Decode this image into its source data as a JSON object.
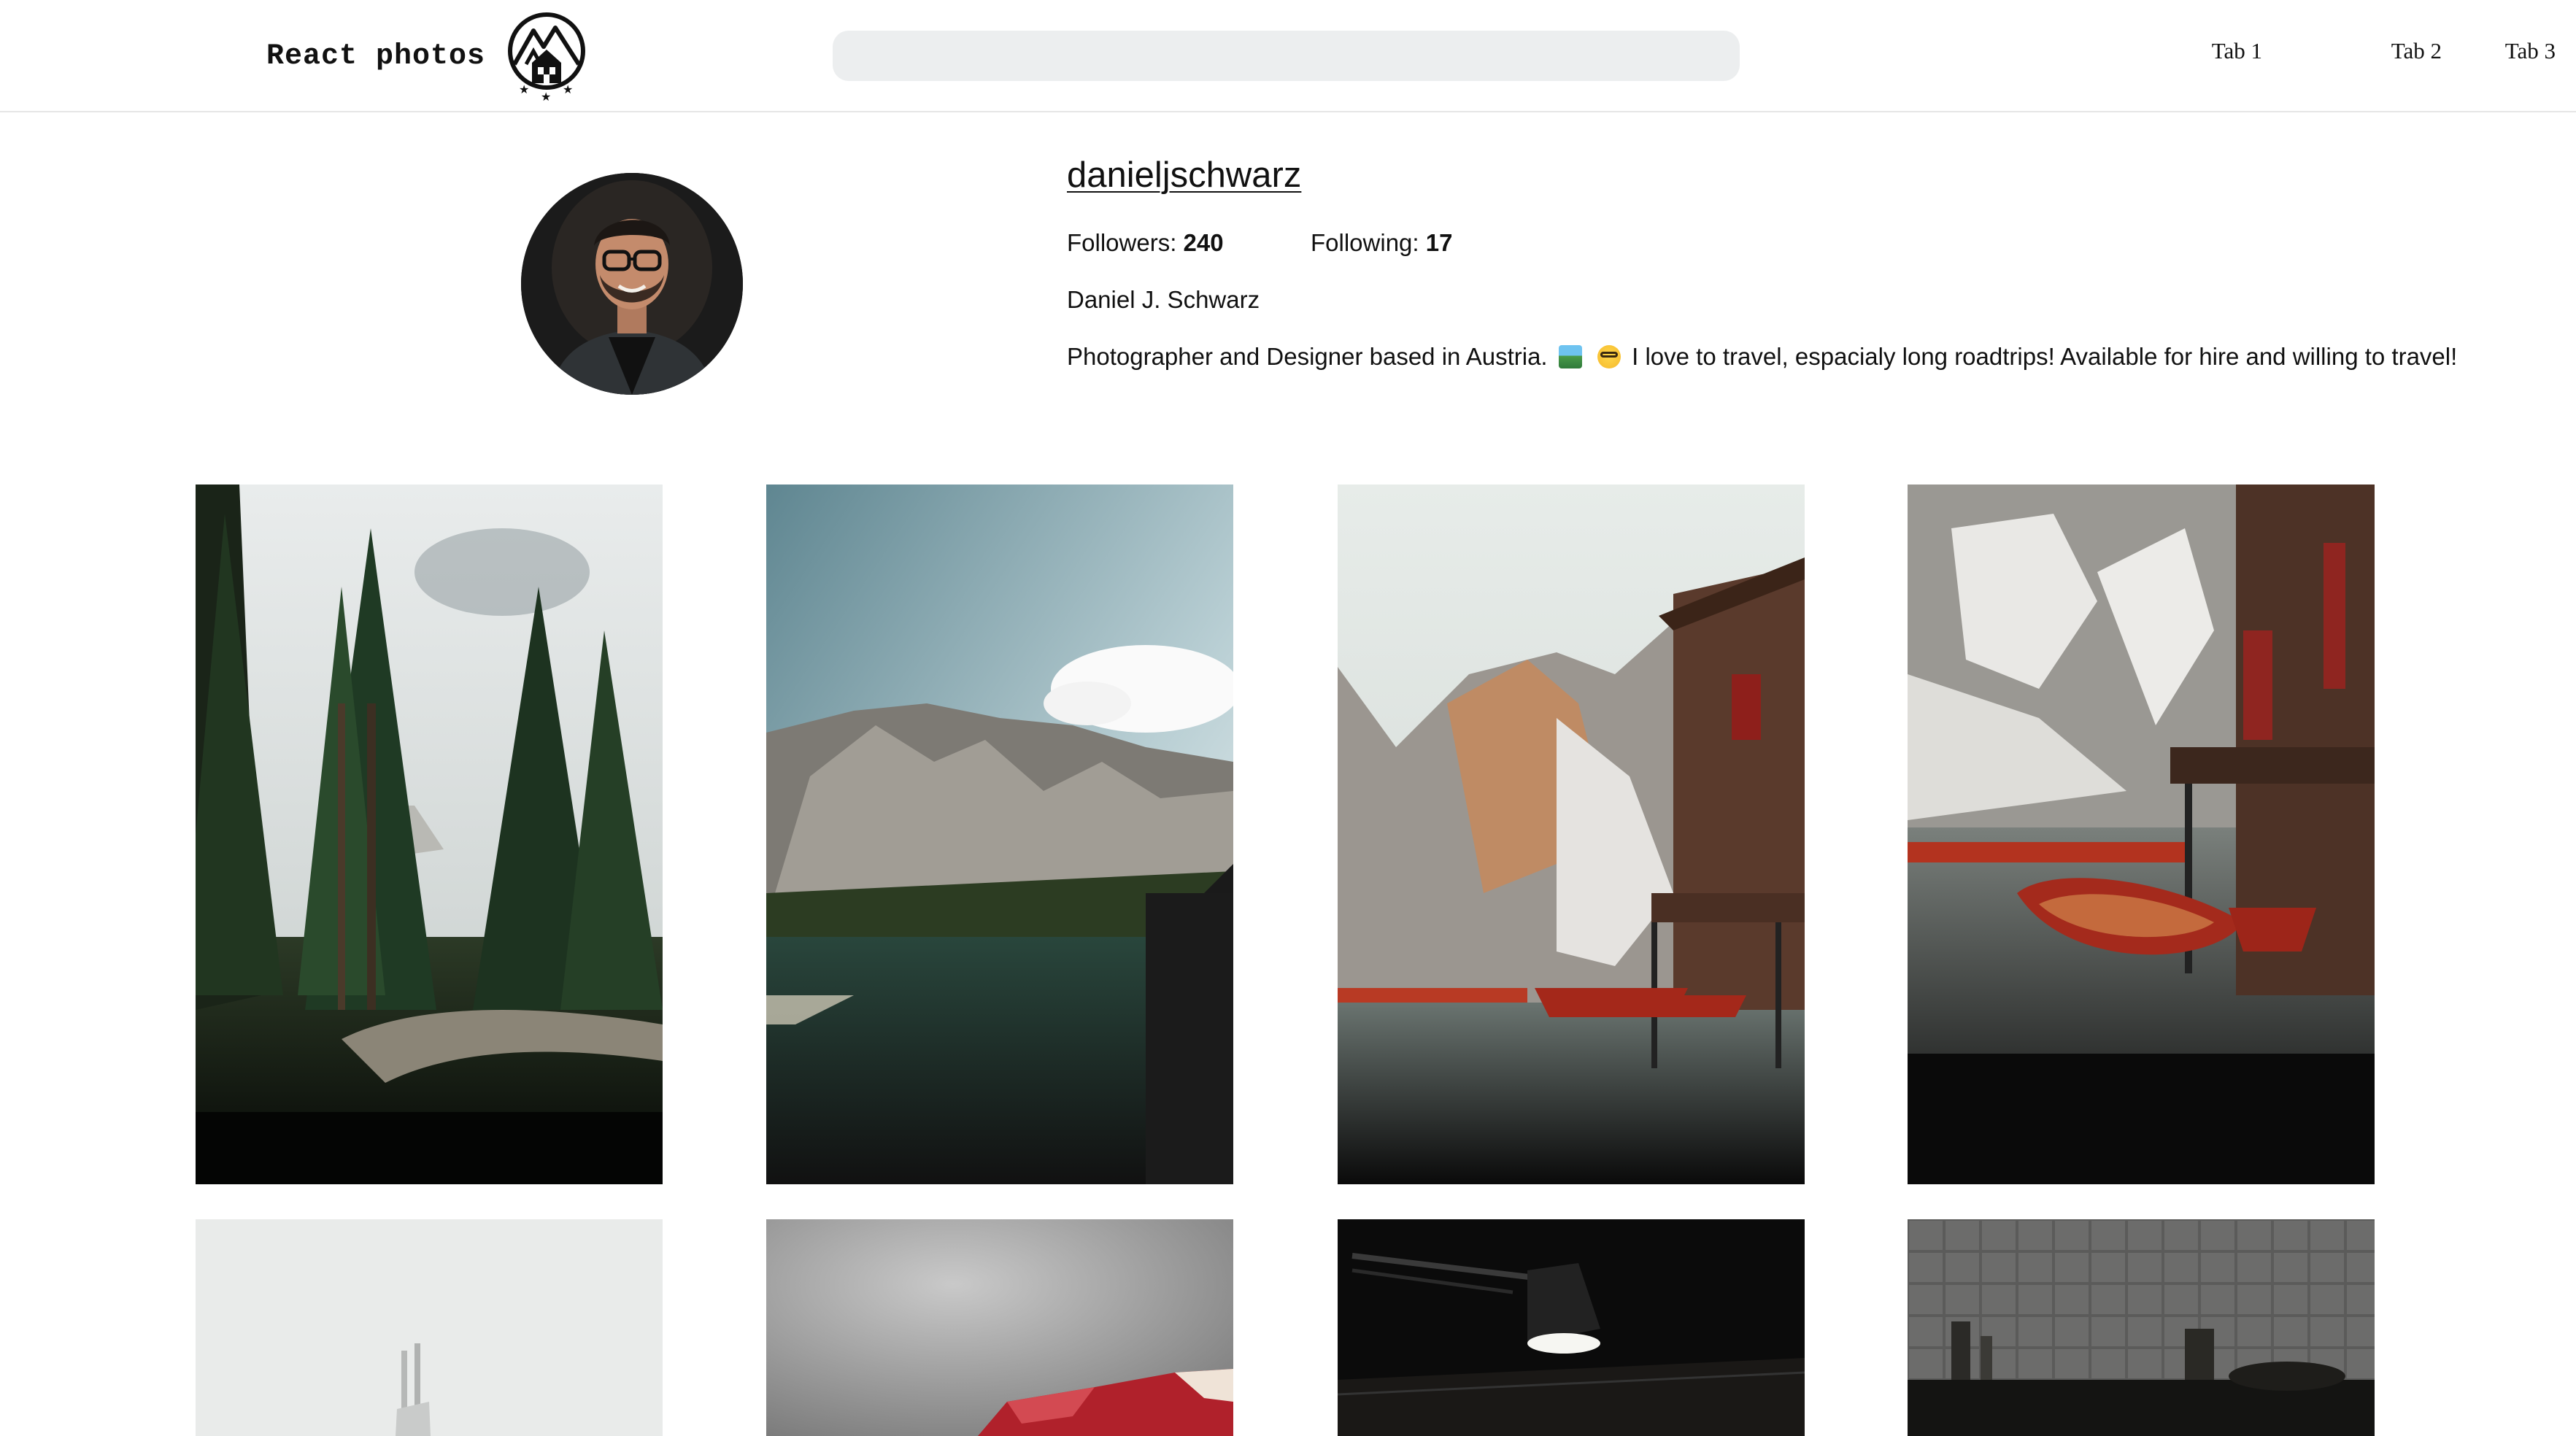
{
  "header": {
    "brand": "React photos",
    "search": {
      "value": "",
      "placeholder": ""
    },
    "tabs": [
      {
        "label": "Tab 1"
      },
      {
        "label": "Tab 2"
      },
      {
        "label": "Tab 3"
      }
    ]
  },
  "profile": {
    "username": "danieljschwarz",
    "followers": {
      "label": "Followers:",
      "count": "240"
    },
    "following": {
      "label": "Following:",
      "count": "17"
    },
    "full_name": "Daniel J. Schwarz",
    "bio_before": "Photographer and Designer based in Austria.",
    "bio_emojis": [
      "photo-emoji",
      "nerd-face-emoji"
    ],
    "bio_after": "I love to travel, espacialy long roadtrips! Available for hire and willing to travel!"
  },
  "grid": {
    "photos": [
      {
        "subject": "forest-path"
      },
      {
        "subject": "mountain-lake"
      },
      {
        "subject": "boathouse-mountain"
      },
      {
        "subject": "boathouse-red-boats"
      },
      {
        "subject": "misty-tower"
      },
      {
        "subject": "red-fabric-grey-wall"
      },
      {
        "subject": "desk-lamp-dark"
      },
      {
        "subject": "tiled-kitchen"
      }
    ]
  },
  "colors": {
    "search_bg": "#eceeef",
    "header_border": "#e6e6e6",
    "text": "#111111"
  }
}
